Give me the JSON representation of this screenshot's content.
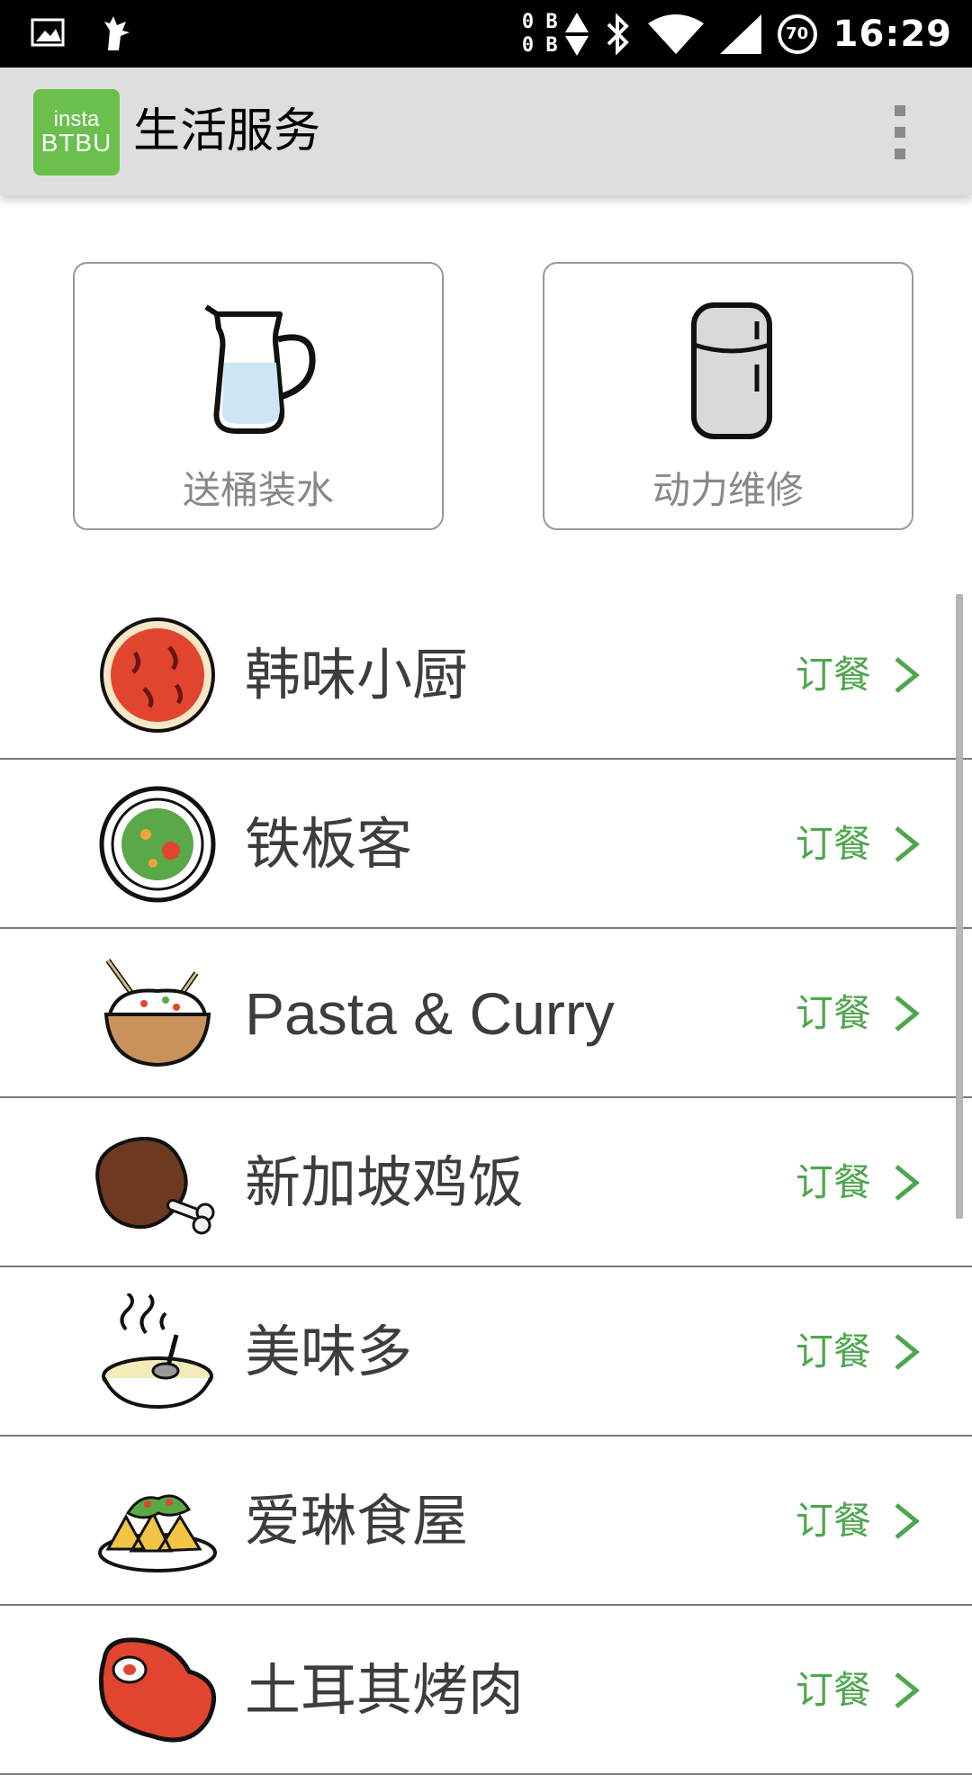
{
  "status_bar": {
    "net_up": "0 B",
    "net_down": "0 B",
    "battery": "70",
    "time": "16:29"
  },
  "app_bar": {
    "logo_line1": "insta",
    "logo_line2": "BTBU",
    "title": "生活服务"
  },
  "services": [
    {
      "label": "送桶装水",
      "icon": "water-pitcher-icon"
    },
    {
      "label": "动力维修",
      "icon": "refrigerator-icon"
    }
  ],
  "restaurants": [
    {
      "name": "韩味小厨",
      "order": "订餐",
      "icon": "pizza-icon"
    },
    {
      "name": "铁板客",
      "order": "订餐",
      "icon": "salad-plate-icon"
    },
    {
      "name": "Pasta & Curry",
      "order": "订餐",
      "icon": "rice-bowl-icon"
    },
    {
      "name": "新加坡鸡饭",
      "order": "订餐",
      "icon": "chicken-leg-icon"
    },
    {
      "name": "美味多",
      "order": "订餐",
      "icon": "soup-bowl-icon"
    },
    {
      "name": "爱琳食屋",
      "order": "订餐",
      "icon": "nachos-icon"
    },
    {
      "name": "土耳其烤肉",
      "order": "订餐",
      "icon": "steak-icon"
    }
  ],
  "colors": {
    "accent_green": "#4ea64e",
    "logo_green": "#6bbf4d",
    "app_bar": "#dedede"
  }
}
